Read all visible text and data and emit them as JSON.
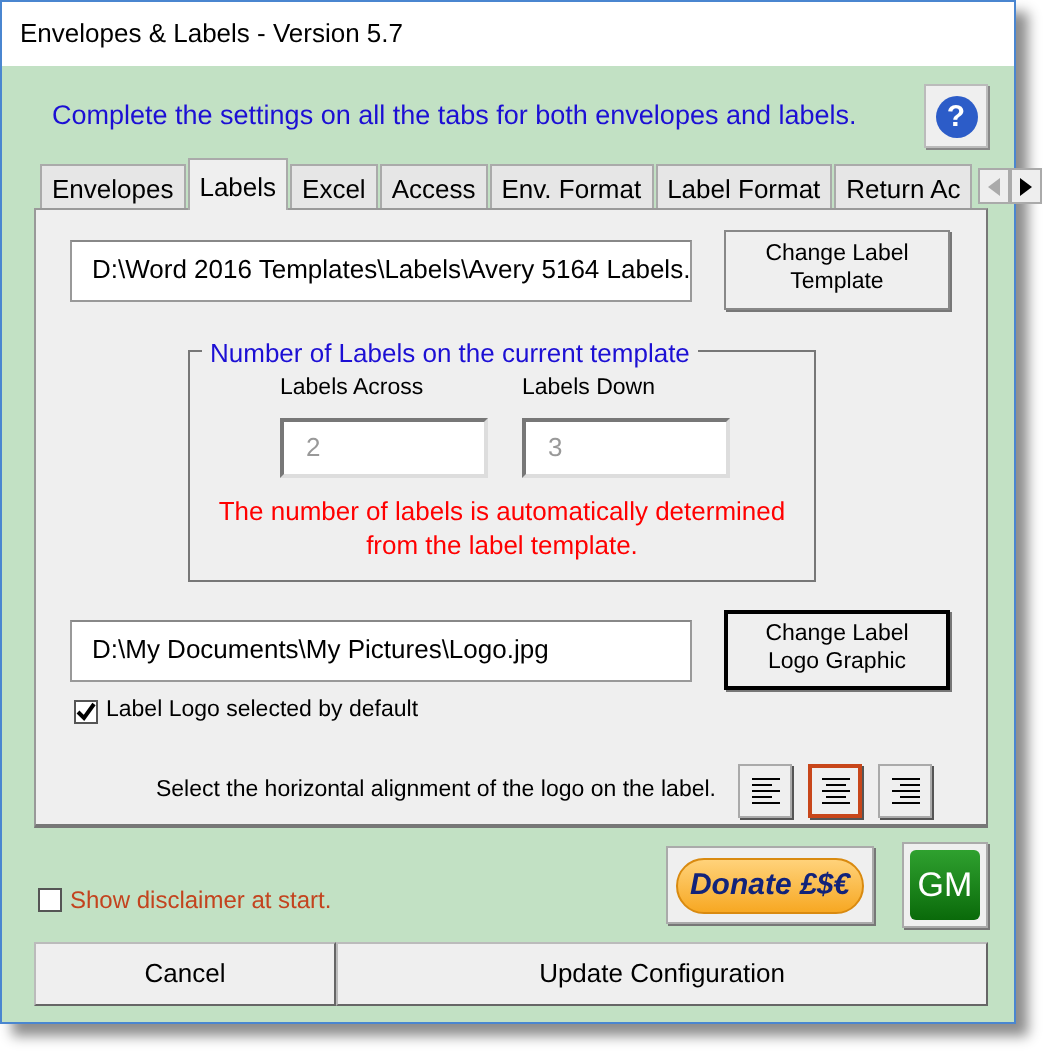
{
  "window": {
    "title": "Envelopes & Labels - Version 5.7"
  },
  "instructions": "Complete the settings on all the tabs for both envelopes and labels.",
  "help_button": {
    "label": "?"
  },
  "tabs": [
    {
      "label": "Envelopes",
      "selected": false
    },
    {
      "label": "Labels",
      "selected": true
    },
    {
      "label": "Excel",
      "selected": false
    },
    {
      "label": "Access",
      "selected": false
    },
    {
      "label": "Env. Format",
      "selected": false
    },
    {
      "label": "Label Format",
      "selected": false
    },
    {
      "label": "Return Ac",
      "selected": false
    }
  ],
  "labels_tab": {
    "template_path": "D:\\Word 2016 Templates\\Labels\\Avery 5164 Labels.",
    "change_template_button": {
      "label": "Change Label Template",
      "default": false
    },
    "group": {
      "title": "Number of Labels on the current template",
      "fields": [
        {
          "label": "Labels Across",
          "value": "2",
          "disabled": true
        },
        {
          "label": "Labels Down",
          "value": "3",
          "disabled": true
        }
      ],
      "note": "The number of labels is automatically determined from the label template."
    },
    "logo_path": "D:\\My Documents\\My Pictures\\Logo.jpg",
    "change_logo_button": {
      "label": "Change Label Logo Graphic",
      "default": true
    },
    "logo_checkbox": {
      "label": "Label Logo selected by default",
      "checked": true
    },
    "alignment": {
      "label": "Select the horizontal alignment of the logo on the label.",
      "options": [
        {
          "kind": "left",
          "selected": false
        },
        {
          "kind": "center",
          "selected": true
        },
        {
          "kind": "right",
          "selected": false
        }
      ]
    }
  },
  "disclaimer_checkbox": {
    "label": "Show disclaimer at start.",
    "checked": false
  },
  "donate_button": {
    "label": "Donate £$€"
  },
  "gm_button": {
    "label": "GM"
  },
  "buttons": [
    "Cancel",
    "Update Configuration"
  ]
}
